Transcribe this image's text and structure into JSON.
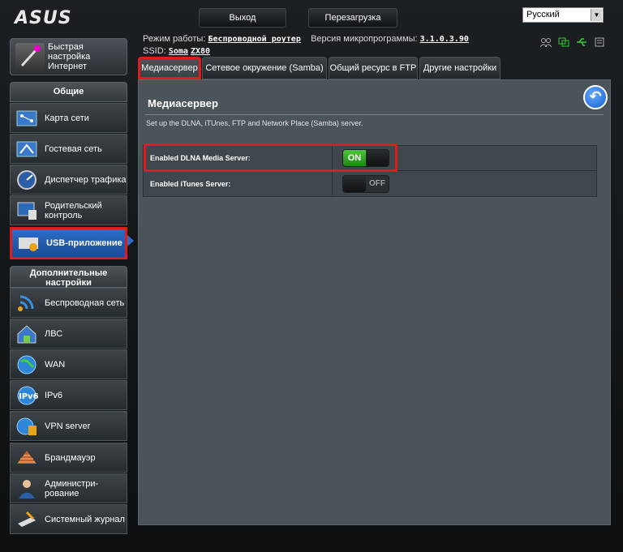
{
  "header": {
    "logo": "ASUS",
    "logout_label": "Выход",
    "reboot_label": "Перезагрузка",
    "language": "Русский",
    "mode_label": "Режим работы:",
    "mode_value": "Беспроводной роутер",
    "firmware_label": "Версия микропрограммы:",
    "firmware_value": "3.1.0.3.90",
    "ssid_label": "SSID:",
    "ssid_values": [
      "Soma",
      "ZX80"
    ]
  },
  "sidebar": {
    "quick_setup": "Быстрая настройка Интернет",
    "general_header": "Общие",
    "general_items": [
      {
        "label": "Карта сети",
        "icon": "network-map-icon"
      },
      {
        "label": "Гостевая сеть",
        "icon": "guest-network-icon"
      },
      {
        "label": "Диспетчер трафика",
        "icon": "traffic-manager-icon"
      },
      {
        "label": "Родительский контроль",
        "icon": "parental-control-icon"
      },
      {
        "label": "USB-приложение",
        "icon": "usb-application-icon"
      }
    ],
    "advanced_header": "Дополнительные настройки",
    "advanced_items": [
      {
        "label": "Беспроводная сеть",
        "icon": "wireless-icon"
      },
      {
        "label": "ЛВС",
        "icon": "lan-icon"
      },
      {
        "label": "WAN",
        "icon": "wan-globe-icon"
      },
      {
        "label": "IPv6",
        "icon": "ipv6-icon"
      },
      {
        "label": "VPN server",
        "icon": "vpn-icon"
      },
      {
        "label": "Брандмауэр",
        "icon": "firewall-icon"
      },
      {
        "label": "Администри-рование",
        "icon": "administration-icon"
      },
      {
        "label": "Системный журнал",
        "icon": "system-log-icon"
      }
    ]
  },
  "tabs": [
    "Медиасервер",
    "Сетевое окружение (Samba)",
    "Общий ресурс в FTP",
    "Другие настройки"
  ],
  "main": {
    "title": "Медиасервер",
    "description": "Set up the DLNA, iTUnes, FTP and Network Place (Samba) server.",
    "rows": [
      {
        "label": "Enabled DLNA Media Server:",
        "state": "ON"
      },
      {
        "label": "Enabled iTunes Server:",
        "state": "OFF"
      }
    ]
  },
  "colors": {
    "accent_blue": "#2b6ec8",
    "highlight_red": "#e01b1b",
    "toggle_green": "#1d8a13"
  }
}
